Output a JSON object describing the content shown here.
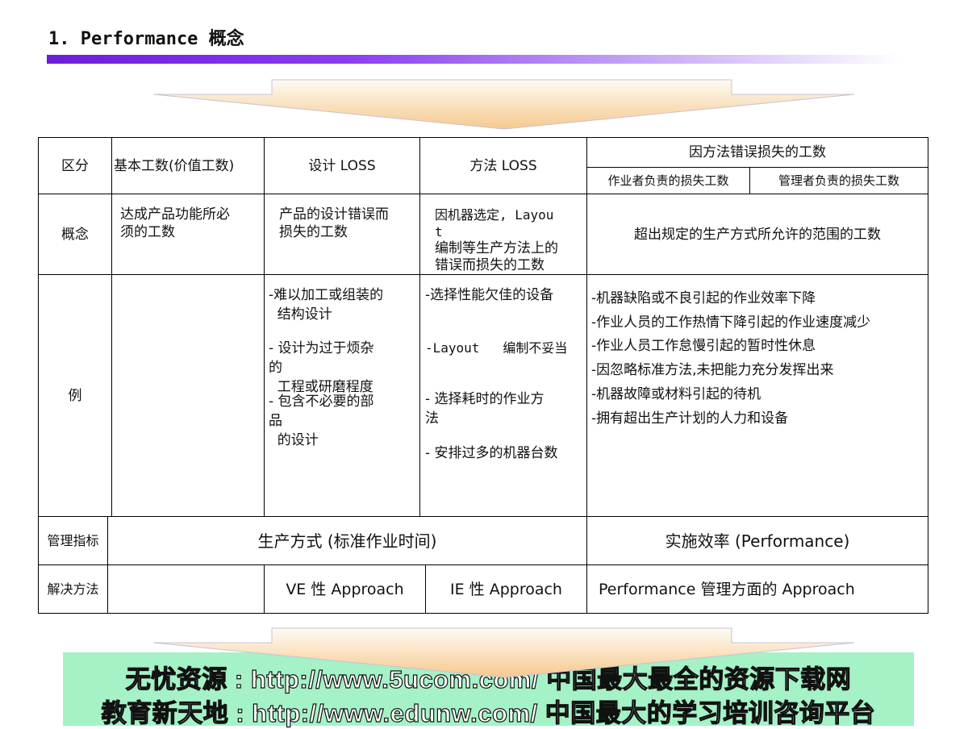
{
  "title": "1. Performance  概念",
  "table": {
    "header": {
      "category": "区分",
      "basic": "基本工数(价值工数)",
      "design": "设计 LOSS",
      "method": "方法 LOSS",
      "method_error": "因方法错误损失的工数",
      "worker_loss": "作业者负责的损失工数",
      "manager_loss": "管理者负责的损失工数"
    },
    "concept": {
      "label": "概念",
      "basic": [
        "达成产品功能所必",
        "须的工数"
      ],
      "design": [
        "产品的设计错误而",
        "损失的工数"
      ],
      "method": [
        "因机器选定, Layou",
        "t",
        "编制等生产方法上的",
        "错误而损失的工数"
      ],
      "error": "超出规定的生产方式所允许的范围的工数"
    },
    "example": {
      "label": "例",
      "design": [
        "-难以加工或组装的",
        "  结构设计",
        "- 设计为过于烦杂",
        "的",
        "  工程或研磨程度",
        "- 包含不必要的部",
        "品",
        "  的设计"
      ],
      "method": [
        "-选择性能欠佳的设备",
        "-Layout   编制不妥当",
        "- 选择耗时的作业方",
        "法",
        "- 安排过多的机器台数"
      ],
      "error": [
        "-机器缺陷或不良引起的作业效率下降",
        "-作业人员的工作热情下降引起的作业速度减少",
        "-作业人员工作怠慢引起的暂时性休息",
        "-因忽略标准方法,未把能力充分发挥出来",
        "-机器故障或材料引起的待机",
        "-拥有超出生产计划的人力和设备"
      ]
    },
    "indicator": {
      "label": "管理指标",
      "left": "生产方式 (标准作业时间)",
      "right": "实施效率 (Performance)"
    },
    "solution": {
      "label": "解决方法",
      "ve": "VE 性 Approach",
      "ie": "IE 性 Approach",
      "perf": "Performance 管理方面的 Approach"
    }
  },
  "footer": {
    "line1": "无忧资源 : http://www.5ucom.com/ 中国最大最全的资源下载网",
    "line2": "教育新天地 : http://www.edunw.com/ 中国最大的学习培训咨询平台"
  },
  "colors": {
    "title_bar": "#6a1fd6",
    "arrow_top": "#fdfbf3",
    "arrow_bottom": "#f6c98e",
    "footer_bg": "#a4f2c6"
  }
}
